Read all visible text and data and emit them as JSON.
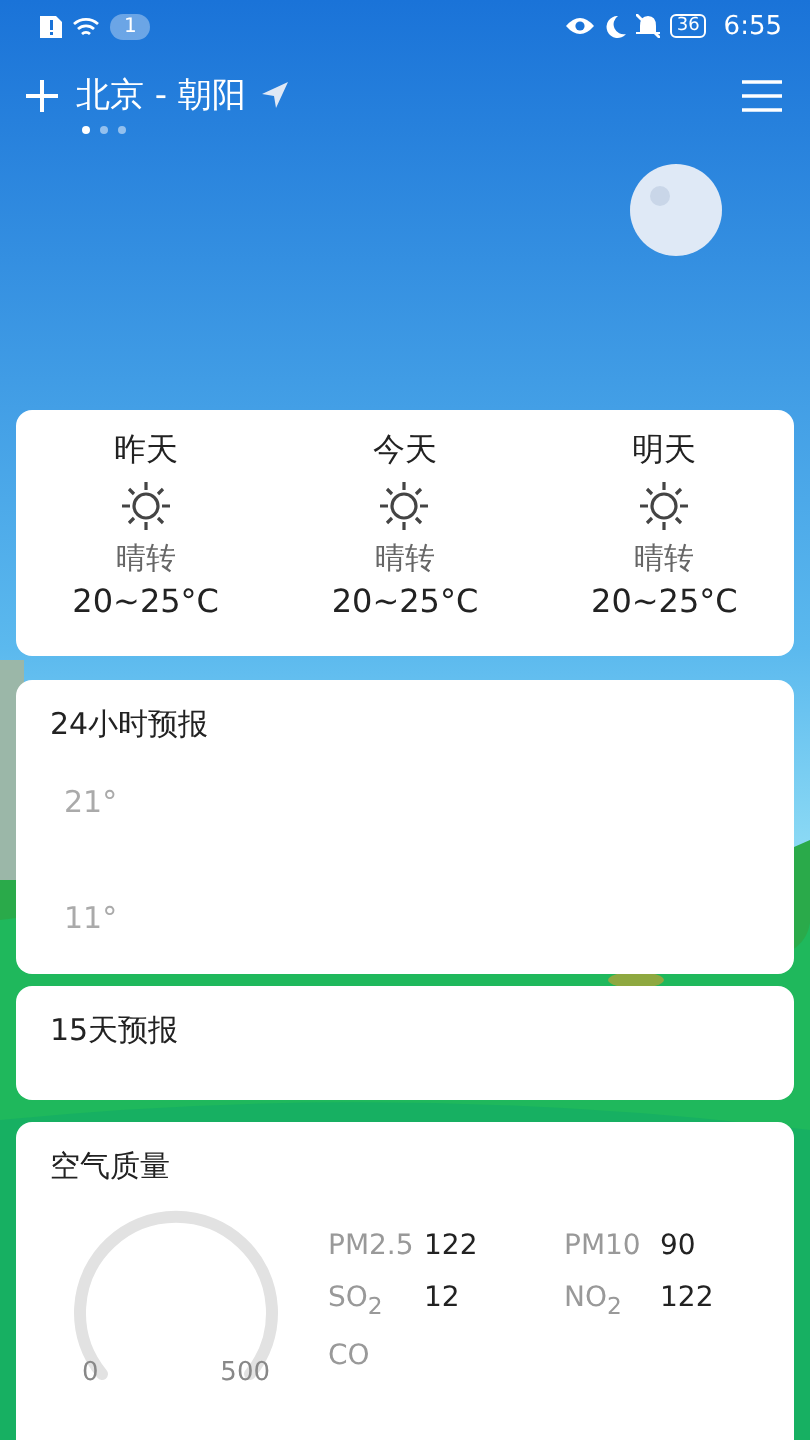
{
  "status_bar": {
    "notification_count": "1",
    "battery": "36",
    "time": "6:55"
  },
  "header": {
    "city": "北京 - 朝阳",
    "pages": [
      {
        "selected": true
      },
      {
        "selected": false
      },
      {
        "selected": false
      }
    ]
  },
  "days": [
    {
      "label": "昨天",
      "condition": "晴转",
      "temp": "20~25°C"
    },
    {
      "label": "今天",
      "condition": "晴转",
      "temp": "20~25°C"
    },
    {
      "label": "明天",
      "condition": "晴转",
      "temp": "20~25°C"
    }
  ],
  "hourly": {
    "title": "24小时预报",
    "y_labels": [
      "21°",
      "11°"
    ]
  },
  "daily": {
    "title": "15天预报"
  },
  "air_quality": {
    "title": "空气质量",
    "gauge_min": "0",
    "gauge_max": "500",
    "items": [
      {
        "label": "PM2.5",
        "value": "122"
      },
      {
        "label": "PM10",
        "value": "90"
      },
      {
        "label": "SO$_{2}$",
        "value": "12"
      },
      {
        "label": "NO$_{2}$",
        "value": "122"
      },
      {
        "label": "CO"
      }
    ]
  }
}
